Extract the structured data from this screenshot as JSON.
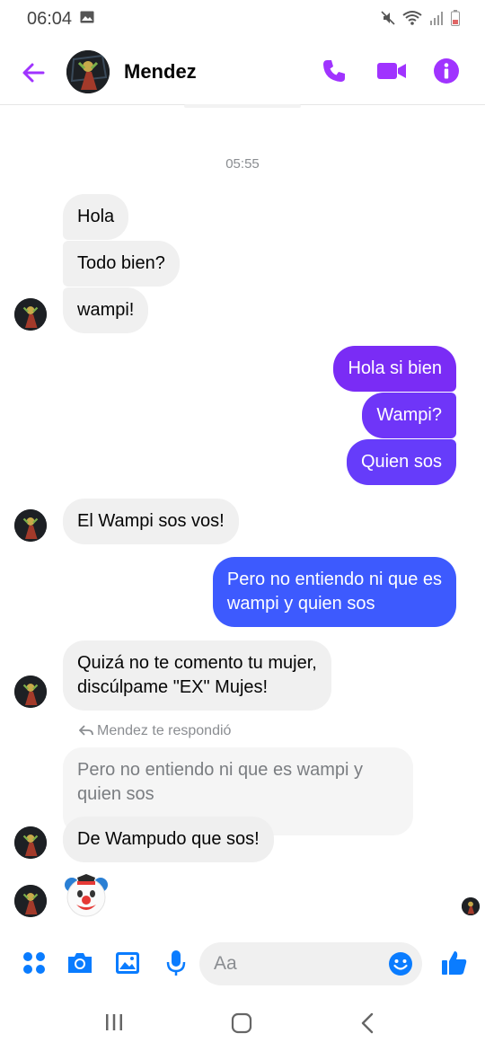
{
  "status_bar": {
    "time": "06:04"
  },
  "header": {
    "contact_name": "Mendez"
  },
  "timestamp": "05:55",
  "messages_in_1": [
    "Hola",
    "Todo bien?",
    "wampi!"
  ],
  "messages_out_1": [
    "Hola si bien",
    "Wampi?",
    "Quien sos"
  ],
  "message_in_2": "El Wampi sos vos!",
  "message_out_2": {
    "line1": "Pero no entiendo ni que es",
    "line2": "wampi y quien sos"
  },
  "message_in_3": {
    "line1": "Quizá no te comento tu mujer,",
    "line2": "discúlpame \"EX\" Mujes!"
  },
  "reply": {
    "label": "Mendez te respondió",
    "quoted_line1": "Pero no entiendo ni que es wampi y",
    "quoted_line2": "quien sos",
    "text": "De Wampudo que sos!"
  },
  "emoji_message": "clown-emoji",
  "composer": {
    "placeholder": "Aa"
  },
  "colors": {
    "accent": "#a033ff",
    "out_top": "#7a2cf5",
    "out_bottom": "#3d5afe",
    "like": "#0a7cff"
  }
}
